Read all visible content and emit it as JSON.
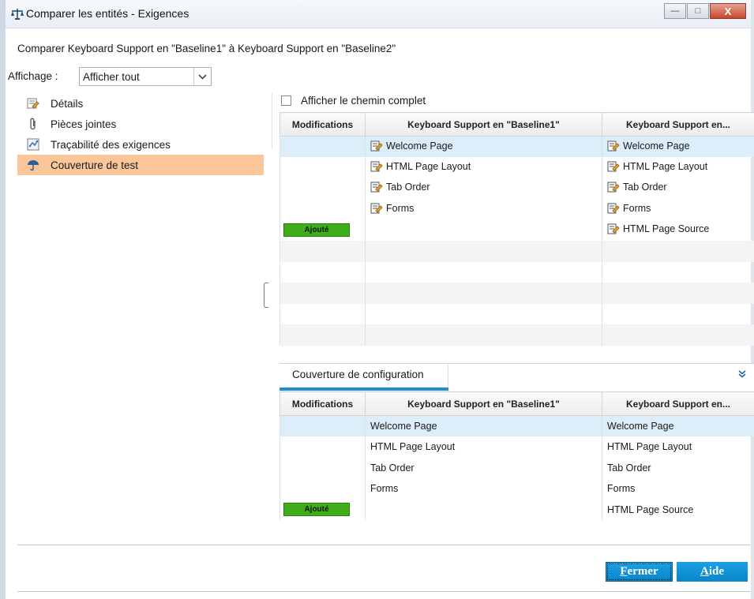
{
  "window": {
    "title": "Comparer les entités - Exigences",
    "minimize_glyph": "—",
    "maximize_glyph": "□",
    "close_glyph": "X"
  },
  "compare_label": "Comparer Keyboard Support en \"Baseline1\" à Keyboard Support en \"Baseline2\"",
  "view": {
    "label": "Affichage :",
    "selected": "Afficher tout"
  },
  "nav": {
    "items": [
      {
        "label": "Détails",
        "icon": "details-icon"
      },
      {
        "label": "Pièces jointes",
        "icon": "paperclip-icon"
      },
      {
        "label": "Traçabilité des exigences",
        "icon": "traceability-icon"
      },
      {
        "label": "Couverture de test",
        "icon": "umbrella-icon",
        "selected": true
      }
    ]
  },
  "fullpath_label": "Afficher le chemin complet",
  "grid1": {
    "headers": [
      "Modifications",
      "Keyboard Support en \"Baseline1\"",
      "Keyboard Support en..."
    ],
    "rows": [
      {
        "mod": "",
        "b1": "Welcome Page",
        "b2": "Welcome Page"
      },
      {
        "mod": "",
        "b1": "HTML Page Layout",
        "b2": "HTML Page Layout"
      },
      {
        "mod": "",
        "b1": "Tab Order",
        "b2": "Tab Order"
      },
      {
        "mod": "",
        "b1": "Forms",
        "b2": "Forms"
      },
      {
        "mod": "Ajouté",
        "b1": "",
        "b2": "HTML Page Source"
      }
    ]
  },
  "config_tab": {
    "label": "Couverture de configuration"
  },
  "grid2": {
    "headers": [
      "Modifications",
      "Keyboard Support en \"Baseline1\"",
      "Keyboard Support en..."
    ],
    "rows": [
      {
        "mod": "",
        "b1": "Welcome Page",
        "b2": "Welcome Page"
      },
      {
        "mod": "",
        "b1": "HTML Page Layout",
        "b2": "HTML Page Layout"
      },
      {
        "mod": "",
        "b1": "Tab Order",
        "b2": "Tab Order"
      },
      {
        "mod": "",
        "b1": "Forms",
        "b2": "Forms"
      },
      {
        "mod": "Ajouté",
        "b1": "",
        "b2": "HTML Page Source"
      }
    ]
  },
  "buttons": {
    "close_accel": "F",
    "close_rest": "ermer",
    "help_accel": "A",
    "help_rest": "ide"
  },
  "colors": {
    "selected_nav": "#fbc69a",
    "selected_row": "#dbeef9",
    "added_badge": "#3fae18",
    "button_blue": "#0a85c7"
  }
}
